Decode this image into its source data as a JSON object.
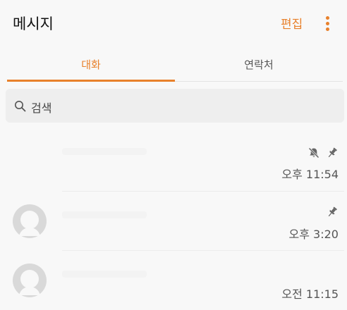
{
  "header": {
    "title": "메시지",
    "edit_label": "편집"
  },
  "tabs": [
    {
      "label": "대화",
      "active": true
    },
    {
      "label": "연락처",
      "active": false
    }
  ],
  "search": {
    "placeholder": "검색"
  },
  "conversations": [
    {
      "time": "오후 11:54",
      "muted": true,
      "pinned": true,
      "avatar": "none"
    },
    {
      "time": "오후 3:20",
      "muted": false,
      "pinned": true,
      "avatar": "default-avatar"
    },
    {
      "time": "오전 11:15",
      "muted": false,
      "pinned": false,
      "avatar": "default-avatar"
    }
  ],
  "colors": {
    "accent": "#e8812c",
    "background": "#f8f8f8",
    "search_bg": "#eeeeee"
  }
}
